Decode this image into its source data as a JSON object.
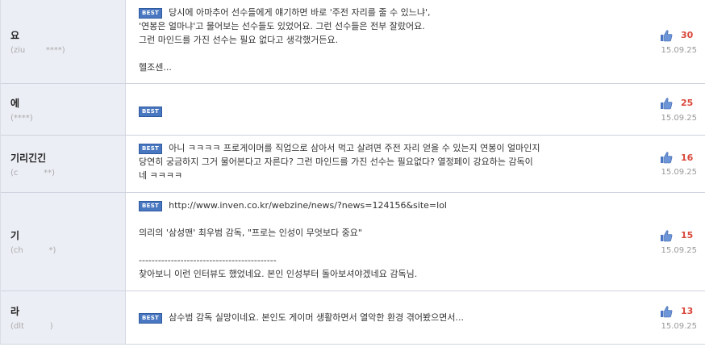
{
  "comments": [
    {
      "nick": "요",
      "uid": "(ziu        ****)",
      "best": "BEST",
      "lines": [
        "당시에 아마추어 선수들에게 얘기하면 바로 '주전 자리를 줄 수 있느냐',",
        "'연봉은 얼마냐'고 물어보는 선수들도 있었어요. 그런 선수들은 전부 잘랐어요.",
        "그런 마인드를 가진 선수는 필요 없다고 생각했거든요.",
        "",
        "헬조센..."
      ],
      "votes": "30",
      "date": "15.09.25"
    },
    {
      "nick": "에",
      "uid": "(****)",
      "best": "BEST",
      "lines": [],
      "votes": "25",
      "date": "15.09.25"
    },
    {
      "nick": "기리긴긴",
      "uid": "(c          **)",
      "best": "BEST",
      "lines": [
        "아니 ㅋㅋㅋㅋ 프로게이머를 직업으로 삼아서 먹고 살려면 주전 자리 얻을 수 있는지 연봉이 얼마인지",
        "당연히 궁금하지 그거 물어본다고 자른다? 그런 마인드를 가진 선수는 필요없다? 열정페이 강요하는 감독이",
        "네 ㅋㅋㅋㅋ"
      ],
      "votes": "16",
      "date": "15.09.25"
    },
    {
      "nick": "기",
      "uid": "(ch          *)",
      "best": "BEST",
      "lines": [
        "http://www.inven.co.kr/webzine/news/?news=124156&site=lol",
        "",
        "의리의 '삼성맨' 최우범 감독, \"프로는 인성이 무엇보다 중요\"",
        "",
        "-------------------------------------------",
        "찾아보니 이런 인터뷰도 했었네요. 본인 인성부터 돌아보셔야겠네요 감독님."
      ],
      "votes": "15",
      "date": "15.09.25"
    },
    {
      "nick": "라",
      "uid": "(dlt          )",
      "best": "BEST",
      "lines": [
        "삼수범 감독 실망이네요. 본인도 게이머 생활하면서 열악한 환경 겪어봤으면서..."
      ],
      "votes": "13",
      "date": "15.09.25"
    }
  ],
  "colors": {
    "best_bg": "#4a78c0",
    "vote_count": "#d9483b",
    "left_bg": "#eceef5"
  },
  "icons": {
    "vote": "thumbs-up-icon"
  }
}
